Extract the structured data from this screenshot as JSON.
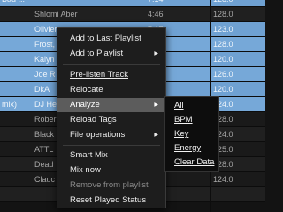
{
  "tracks": [
    {
      "c0": "Bad ...",
      "c1": "",
      "c2": "7:14",
      "c3": "128.0",
      "selected": true
    },
    {
      "c0": "",
      "c1": "Shlomi Aber",
      "c2": "4:46",
      "c3": "128.0",
      "selected": false
    },
    {
      "c0": "",
      "c1": "Olivier",
      "c2": "7:17",
      "c3": "123.0",
      "selected": true
    },
    {
      "c0": "",
      "c1": "Frost,",
      "c2": "6:26",
      "c3": "128.0",
      "selected": true
    },
    {
      "c0": "",
      "c1": "Kalyn",
      "c2": "8:48",
      "c3": "120.0",
      "selected": true
    },
    {
      "c0": "",
      "c1": "Joe R",
      "c2": "5:56",
      "c3": "126.0",
      "selected": true
    },
    {
      "c0": "",
      "c1": "DkA",
      "c2": "9:57",
      "c3": "120.0",
      "selected": true
    },
    {
      "c0": "mix)",
      "c1": "DJ He",
      "c2": "",
      "c3": "124.0",
      "selected": true
    },
    {
      "c0": "",
      "c1": "Rober",
      "c2": "",
      "c3": "128.0",
      "selected": false
    },
    {
      "c0": "",
      "c1": "Black",
      "c2": "",
      "c3": "124.0",
      "selected": false
    },
    {
      "c0": "",
      "c1": "ATTL",
      "c2": "",
      "c3": "125.0",
      "selected": false
    },
    {
      "c0": "",
      "c1": "Dead",
      "c2": "8:45",
      "c3": "128.0",
      "selected": false
    },
    {
      "c0": "",
      "c1": "Clauc",
      "c2": "5:21",
      "c3": "124.0",
      "selected": false
    },
    {
      "c0": "",
      "c1": "",
      "c2": "",
      "c3": "",
      "selected": false
    }
  ],
  "context_menu": {
    "add_to_last_playlist": "Add to Last Playlist",
    "add_to_playlist": "Add to Playlist",
    "pre_listen_track": "Pre-listen Track",
    "relocate": "Relocate",
    "analyze": "Analyze",
    "reload_tags": "Reload Tags",
    "file_operations": "File operations",
    "smart_mix": "Smart Mix",
    "mix_now": "Mix now",
    "remove_from_playlist": "Remove from playlist",
    "reset_played_status": "Reset Played Status"
  },
  "analyze_submenu": {
    "all": "All",
    "bpm": "BPM",
    "key": "Key",
    "energy": "Energy",
    "clear_data": "Clear Data"
  },
  "arrow_glyph": "▶",
  "colors": {
    "selected_row": "#6fa1d2",
    "menu_background": "#1d1d1d",
    "menu_highlight": "#5c5c5c"
  }
}
